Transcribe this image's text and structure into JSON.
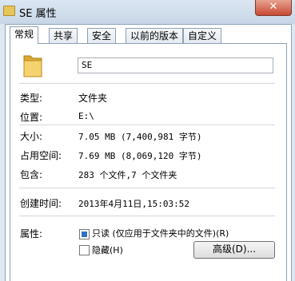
{
  "window": {
    "title": "SE 属性",
    "close_label": "✕"
  },
  "tabs": [
    {
      "label": "常规",
      "active": true
    },
    {
      "label": "共享"
    },
    {
      "label": "安全"
    },
    {
      "label": "以前的版本"
    },
    {
      "label": "自定义"
    }
  ],
  "general": {
    "name": "SE",
    "type_label": "类型:",
    "type_value": "文件夹",
    "location_label": "位置:",
    "location_value": "E:\\",
    "size_label": "大小:",
    "size_value": "7.05 MB (7,400,981 字节)",
    "disk_size_label": "占用空间:",
    "disk_size_value": "7.69 MB (8,069,120 字节)",
    "contains_label": "包含:",
    "contains_value": "283 个文件,7 个文件夹",
    "created_label": "创建时间:",
    "created_value": "2013年4月11日,15:03:52",
    "attributes_label": "属性:",
    "readonly_label": "只读 (仅应用于文件夹中的文件)(R)",
    "readonly_checked": true,
    "hidden_label": "隐藏(H)",
    "hidden_checked": false,
    "advanced_button": "高级(D)..."
  },
  "colors": {
    "accent": "#2f6fc4",
    "folder": "#e8c55a"
  }
}
